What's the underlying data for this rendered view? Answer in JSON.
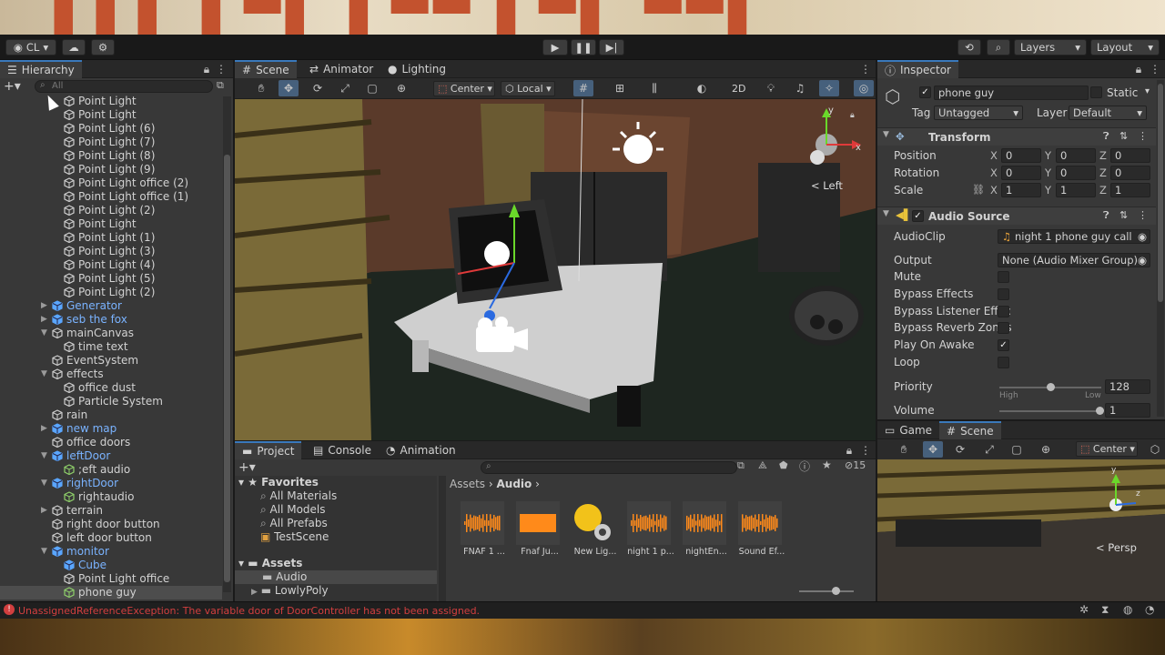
{
  "toolbar": {
    "account": "CL",
    "layers": "Layers",
    "layout": "Layout"
  },
  "hierarchy": {
    "tab": "Hierarchy",
    "search_placeholder": "All",
    "items": [
      {
        "label": "Point Light",
        "indent": 2,
        "type": "obj"
      },
      {
        "label": "Point Light",
        "indent": 2,
        "type": "obj"
      },
      {
        "label": "Point Light (6)",
        "indent": 2,
        "type": "obj"
      },
      {
        "label": "Point Light (7)",
        "indent": 2,
        "type": "obj"
      },
      {
        "label": "Point Light (8)",
        "indent": 2,
        "type": "obj"
      },
      {
        "label": "Point Light (9)",
        "indent": 2,
        "type": "obj"
      },
      {
        "label": "Point Light office (2)",
        "indent": 2,
        "type": "obj"
      },
      {
        "label": "Point Light office (1)",
        "indent": 2,
        "type": "obj"
      },
      {
        "label": "Point Light (2)",
        "indent": 2,
        "type": "obj"
      },
      {
        "label": "Point Light",
        "indent": 2,
        "type": "obj"
      },
      {
        "label": "Point Light (1)",
        "indent": 2,
        "type": "obj"
      },
      {
        "label": "Point Light (3)",
        "indent": 2,
        "type": "obj"
      },
      {
        "label": "Point Light (4)",
        "indent": 2,
        "type": "obj"
      },
      {
        "label": "Point Light (5)",
        "indent": 2,
        "type": "obj"
      },
      {
        "label": "Point Light (2)",
        "indent": 2,
        "type": "obj"
      },
      {
        "label": "Generator",
        "indent": 1,
        "type": "prefab",
        "arrow": "right"
      },
      {
        "label": "seb the fox",
        "indent": 1,
        "type": "prefab",
        "arrow": "right"
      },
      {
        "label": "mainCanvas",
        "indent": 1,
        "type": "obj",
        "arrow": "down"
      },
      {
        "label": "time text",
        "indent": 2,
        "type": "obj"
      },
      {
        "label": "EventSystem",
        "indent": 1,
        "type": "obj"
      },
      {
        "label": "effects",
        "indent": 1,
        "type": "obj",
        "arrow": "down"
      },
      {
        "label": "office dust",
        "indent": 2,
        "type": "obj"
      },
      {
        "label": "Particle System",
        "indent": 2,
        "type": "obj"
      },
      {
        "label": "rain",
        "indent": 1,
        "type": "obj"
      },
      {
        "label": "new map",
        "indent": 1,
        "type": "prefab",
        "arrow": "right"
      },
      {
        "label": "office doors",
        "indent": 1,
        "type": "obj"
      },
      {
        "label": "leftDoor",
        "indent": 1,
        "type": "prefab",
        "arrow": "down"
      },
      {
        "label": ";eft audio",
        "indent": 2,
        "type": "green"
      },
      {
        "label": "rightDoor",
        "indent": 1,
        "type": "prefab",
        "arrow": "down"
      },
      {
        "label": "rightaudio",
        "indent": 2,
        "type": "green"
      },
      {
        "label": "terrain",
        "indent": 1,
        "type": "obj",
        "arrow": "right"
      },
      {
        "label": "right door button",
        "indent": 1,
        "type": "obj"
      },
      {
        "label": "left door button",
        "indent": 1,
        "type": "obj"
      },
      {
        "label": "monitor",
        "indent": 1,
        "type": "prefab",
        "arrow": "down"
      },
      {
        "label": "Cube",
        "indent": 2,
        "type": "prefab"
      },
      {
        "label": "Point Light office",
        "indent": 2,
        "type": "obj"
      },
      {
        "label": "phone guy",
        "indent": 2,
        "type": "green",
        "selected": true
      }
    ]
  },
  "scene": {
    "tabs": [
      "Scene",
      "Animator",
      "Lighting"
    ],
    "pivot": "Center",
    "space": "Local",
    "mode2d": "2D",
    "gizmo_label": "Left"
  },
  "project": {
    "tabs": [
      "Project",
      "Console",
      "Animation"
    ],
    "favorites_label": "Favorites",
    "favorites": [
      "All Materials",
      "All Models",
      "All Prefabs",
      "TestScene"
    ],
    "assets_label": "Assets",
    "folders": [
      "Audio",
      "LowlyPoly"
    ],
    "breadcrumb": [
      "Assets",
      "Audio"
    ],
    "hidden_count": "15",
    "files": [
      "FNAF 1 ...",
      "Fnaf Ju...",
      "New Lig...",
      "night 1 p...",
      "nightEn...",
      "Sound Ef..."
    ]
  },
  "inspector": {
    "tab": "Inspector",
    "name": "phone guy",
    "static_label": "Static",
    "tag_label": "Tag",
    "tag_value": "Untagged",
    "layer_label": "Layer",
    "layer_value": "Default",
    "transform": {
      "title": "Transform",
      "rows": [
        {
          "label": "Position",
          "x": "0",
          "y": "0",
          "z": "0"
        },
        {
          "label": "Rotation",
          "x": "0",
          "y": "0",
          "z": "0"
        },
        {
          "label": "Scale",
          "x": "1",
          "y": "1",
          "z": "1"
        }
      ]
    },
    "audio": {
      "title": "Audio Source",
      "clip_label": "AudioClip",
      "clip_value": "night 1 phone guy call",
      "output_label": "Output",
      "output_value": "None (Audio Mixer Group)",
      "toggles": [
        {
          "label": "Mute",
          "checked": false
        },
        {
          "label": "Bypass Effects",
          "checked": false
        },
        {
          "label": "Bypass Listener Effec",
          "checked": false
        },
        {
          "label": "Bypass Reverb Zones",
          "checked": false
        },
        {
          "label": "Play On Awake",
          "checked": true
        },
        {
          "label": "Loop",
          "checked": false
        }
      ],
      "priority_label": "Priority",
      "priority_value": "128",
      "priority_fraction": 0.5,
      "high_label": "High",
      "low_label": "Low",
      "volume_label": "Volume",
      "volume_value": "1"
    }
  },
  "game": {
    "tabs": [
      "Game",
      "Scene"
    ],
    "pivot": "Center",
    "gizmo_label": "Persp"
  },
  "status": {
    "error": "UnassignedReferenceException: The variable door of DoorController has not been assigned."
  },
  "colors": {
    "accent": "#3a79bb",
    "error": "#d23f3f",
    "prefab": "#7ab3ff"
  }
}
